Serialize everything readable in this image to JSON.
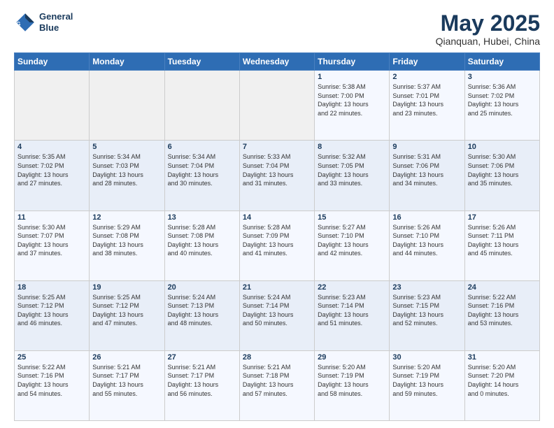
{
  "header": {
    "logo_line1": "General",
    "logo_line2": "Blue",
    "title": "May 2025",
    "subtitle": "Qianquan, Hubei, China"
  },
  "weekdays": [
    "Sunday",
    "Monday",
    "Tuesday",
    "Wednesday",
    "Thursday",
    "Friday",
    "Saturday"
  ],
  "weeks": [
    [
      {
        "day": "",
        "info": ""
      },
      {
        "day": "",
        "info": ""
      },
      {
        "day": "",
        "info": ""
      },
      {
        "day": "",
        "info": ""
      },
      {
        "day": "1",
        "info": "Sunrise: 5:38 AM\nSunset: 7:00 PM\nDaylight: 13 hours\nand 22 minutes."
      },
      {
        "day": "2",
        "info": "Sunrise: 5:37 AM\nSunset: 7:01 PM\nDaylight: 13 hours\nand 23 minutes."
      },
      {
        "day": "3",
        "info": "Sunrise: 5:36 AM\nSunset: 7:02 PM\nDaylight: 13 hours\nand 25 minutes."
      }
    ],
    [
      {
        "day": "4",
        "info": "Sunrise: 5:35 AM\nSunset: 7:02 PM\nDaylight: 13 hours\nand 27 minutes."
      },
      {
        "day": "5",
        "info": "Sunrise: 5:34 AM\nSunset: 7:03 PM\nDaylight: 13 hours\nand 28 minutes."
      },
      {
        "day": "6",
        "info": "Sunrise: 5:34 AM\nSunset: 7:04 PM\nDaylight: 13 hours\nand 30 minutes."
      },
      {
        "day": "7",
        "info": "Sunrise: 5:33 AM\nSunset: 7:04 PM\nDaylight: 13 hours\nand 31 minutes."
      },
      {
        "day": "8",
        "info": "Sunrise: 5:32 AM\nSunset: 7:05 PM\nDaylight: 13 hours\nand 33 minutes."
      },
      {
        "day": "9",
        "info": "Sunrise: 5:31 AM\nSunset: 7:06 PM\nDaylight: 13 hours\nand 34 minutes."
      },
      {
        "day": "10",
        "info": "Sunrise: 5:30 AM\nSunset: 7:06 PM\nDaylight: 13 hours\nand 35 minutes."
      }
    ],
    [
      {
        "day": "11",
        "info": "Sunrise: 5:30 AM\nSunset: 7:07 PM\nDaylight: 13 hours\nand 37 minutes."
      },
      {
        "day": "12",
        "info": "Sunrise: 5:29 AM\nSunset: 7:08 PM\nDaylight: 13 hours\nand 38 minutes."
      },
      {
        "day": "13",
        "info": "Sunrise: 5:28 AM\nSunset: 7:08 PM\nDaylight: 13 hours\nand 40 minutes."
      },
      {
        "day": "14",
        "info": "Sunrise: 5:28 AM\nSunset: 7:09 PM\nDaylight: 13 hours\nand 41 minutes."
      },
      {
        "day": "15",
        "info": "Sunrise: 5:27 AM\nSunset: 7:10 PM\nDaylight: 13 hours\nand 42 minutes."
      },
      {
        "day": "16",
        "info": "Sunrise: 5:26 AM\nSunset: 7:10 PM\nDaylight: 13 hours\nand 44 minutes."
      },
      {
        "day": "17",
        "info": "Sunrise: 5:26 AM\nSunset: 7:11 PM\nDaylight: 13 hours\nand 45 minutes."
      }
    ],
    [
      {
        "day": "18",
        "info": "Sunrise: 5:25 AM\nSunset: 7:12 PM\nDaylight: 13 hours\nand 46 minutes."
      },
      {
        "day": "19",
        "info": "Sunrise: 5:25 AM\nSunset: 7:12 PM\nDaylight: 13 hours\nand 47 minutes."
      },
      {
        "day": "20",
        "info": "Sunrise: 5:24 AM\nSunset: 7:13 PM\nDaylight: 13 hours\nand 48 minutes."
      },
      {
        "day": "21",
        "info": "Sunrise: 5:24 AM\nSunset: 7:14 PM\nDaylight: 13 hours\nand 50 minutes."
      },
      {
        "day": "22",
        "info": "Sunrise: 5:23 AM\nSunset: 7:14 PM\nDaylight: 13 hours\nand 51 minutes."
      },
      {
        "day": "23",
        "info": "Sunrise: 5:23 AM\nSunset: 7:15 PM\nDaylight: 13 hours\nand 52 minutes."
      },
      {
        "day": "24",
        "info": "Sunrise: 5:22 AM\nSunset: 7:16 PM\nDaylight: 13 hours\nand 53 minutes."
      }
    ],
    [
      {
        "day": "25",
        "info": "Sunrise: 5:22 AM\nSunset: 7:16 PM\nDaylight: 13 hours\nand 54 minutes."
      },
      {
        "day": "26",
        "info": "Sunrise: 5:21 AM\nSunset: 7:17 PM\nDaylight: 13 hours\nand 55 minutes."
      },
      {
        "day": "27",
        "info": "Sunrise: 5:21 AM\nSunset: 7:17 PM\nDaylight: 13 hours\nand 56 minutes."
      },
      {
        "day": "28",
        "info": "Sunrise: 5:21 AM\nSunset: 7:18 PM\nDaylight: 13 hours\nand 57 minutes."
      },
      {
        "day": "29",
        "info": "Sunrise: 5:20 AM\nSunset: 7:19 PM\nDaylight: 13 hours\nand 58 minutes."
      },
      {
        "day": "30",
        "info": "Sunrise: 5:20 AM\nSunset: 7:19 PM\nDaylight: 13 hours\nand 59 minutes."
      },
      {
        "day": "31",
        "info": "Sunrise: 5:20 AM\nSunset: 7:20 PM\nDaylight: 14 hours\nand 0 minutes."
      }
    ]
  ]
}
